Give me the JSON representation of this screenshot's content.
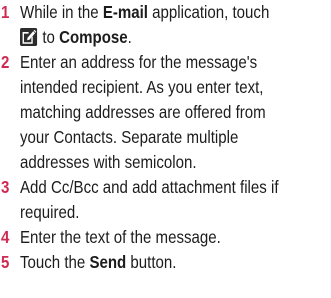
{
  "steps": [
    {
      "number": "1",
      "line1_pre": "While in the ",
      "line1_app": "E-mail",
      "line1_post": " application, touch",
      "icon": "compose-icon",
      "line2_mid": "to ",
      "line2_action": "Compose",
      "line2_end": "."
    },
    {
      "number": "2",
      "lines": [
        "Enter an address for the message's",
        "intended recipient. As you enter text,",
        "matching addresses are offered from",
        "your Contacts. Separate multiple",
        "addresses with semicolon."
      ]
    },
    {
      "number": "3",
      "lines": [
        "Add Cc/Bcc and add attachment files if",
        "required."
      ]
    },
    {
      "number": "4",
      "lines": [
        "Enter the text of the message."
      ]
    },
    {
      "number": "5",
      "line_pre": "Touch the ",
      "line_bold": "Send",
      "line_post": " button."
    }
  ],
  "colors": {
    "step_number": "#cf2b52",
    "icon_background": "#2c2c2c",
    "text": "#1c1c1c"
  }
}
